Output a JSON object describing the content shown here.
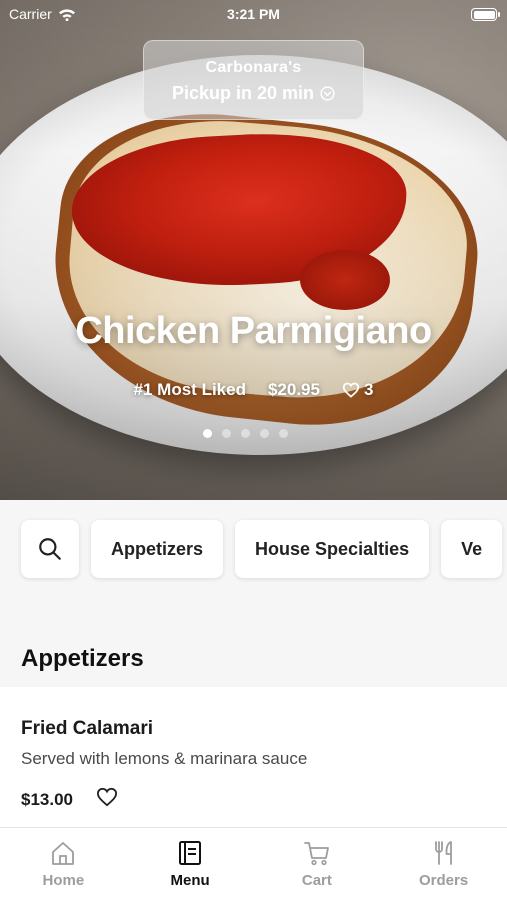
{
  "status_bar": {
    "carrier": "Carrier",
    "time": "3:21 PM"
  },
  "store": {
    "name": "Carbonara's",
    "pickup": "Pickup in 20 min"
  },
  "featured": {
    "title": "Chicken Parmigiano",
    "rank": "#1 Most Liked",
    "price": "$20.95",
    "likes": "3",
    "carousel_count": 5,
    "carousel_index": 0
  },
  "categories": [
    "Appetizers",
    "House Specialties",
    "Ve"
  ],
  "section": {
    "title": "Appetizers"
  },
  "items": [
    {
      "name": "Fried Calamari",
      "description": "Served with lemons & marinara sauce",
      "price": "$13.00"
    }
  ],
  "tabs": [
    {
      "label": "Home",
      "icon": "home-icon",
      "active": false
    },
    {
      "label": "Menu",
      "icon": "menu-book-icon",
      "active": true
    },
    {
      "label": "Cart",
      "icon": "cart-icon",
      "active": false
    },
    {
      "label": "Orders",
      "icon": "fork-knife-icon",
      "active": false
    }
  ]
}
